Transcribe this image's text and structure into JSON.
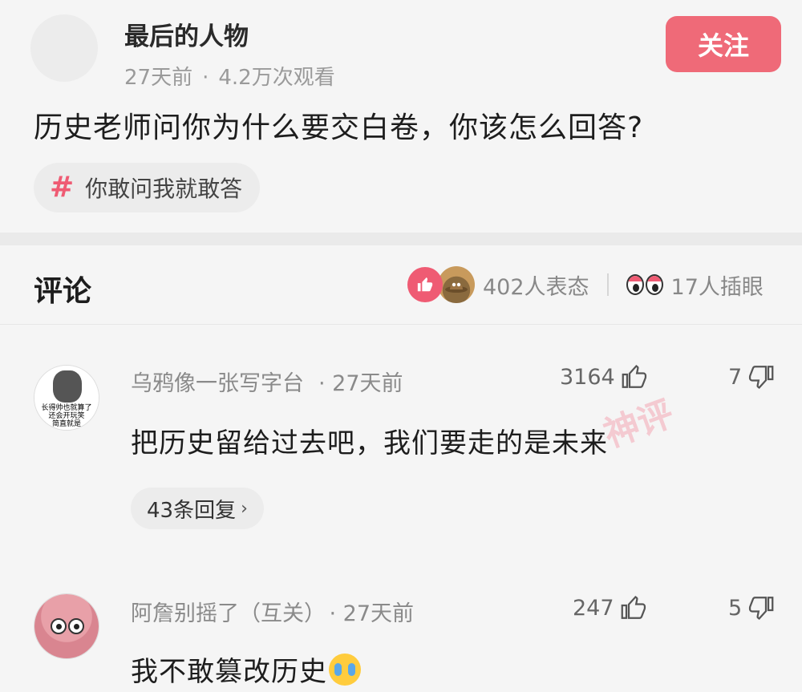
{
  "post": {
    "author": "最后的人物",
    "time": "27天前",
    "views": "4.2万次观看",
    "separator": "·",
    "follow_label": "关注",
    "question": "历史老师问你为什么要交白卷，你该怎么回答?",
    "topic_hash": "#",
    "topic": "你敢问我就敢答"
  },
  "comments_header": {
    "title": "评论",
    "reactions": "402人表态",
    "peeks": "17人插眼"
  },
  "comments": [
    {
      "author": "乌鸦像一张写字台",
      "time": "· 27天前",
      "likes": "3164",
      "dislikes": "7",
      "body": "把历史留给过去吧，我们要走的是未来",
      "avatar_caption": "长得帅也就算了\n还会开玩笑\n简直就是",
      "replies": "43条回复",
      "stamp": "神评"
    },
    {
      "author": "阿詹别摇了（互关）",
      "time": "· 27天前",
      "likes": "247",
      "dislikes": "5",
      "body": "我不敢篡改历史"
    }
  ],
  "colors": {
    "accent": "#ef6a78",
    "topic_hash": "#ef5b73",
    "meta_text": "#9a9a9a",
    "background": "#f5f5f5"
  },
  "icons": {
    "like": "thumb-up-icon",
    "dislike": "thumb-down-icon",
    "reaction_like": "like-reaction-icon",
    "reaction_hat": "hat-reaction-icon",
    "peek": "eyes-icon",
    "cry": "crying-emoji-icon",
    "chevron": "chevron-right-icon"
  }
}
